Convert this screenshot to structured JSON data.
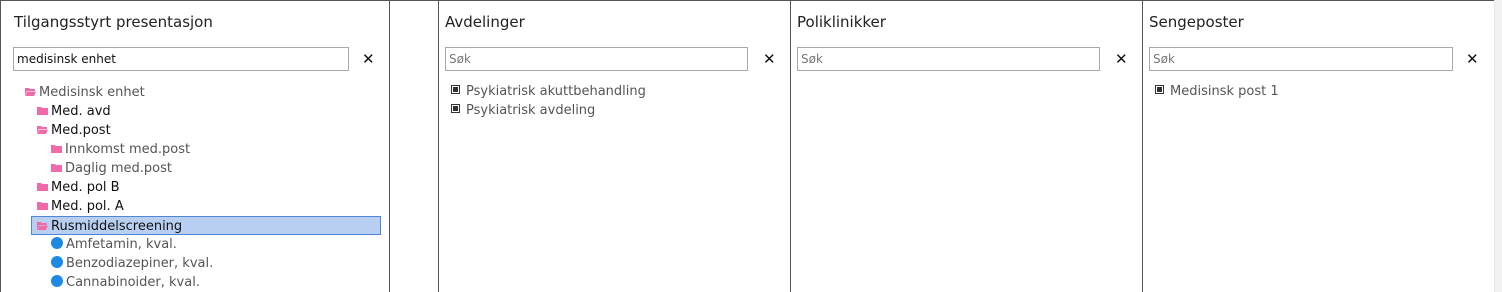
{
  "tilgang": {
    "title": "Tilgangsstyrt presentasjon",
    "search_value": "medisinsk enhet",
    "clear_symbol": "✕",
    "tree": [
      {
        "label": "Medisinsk enhet",
        "type": "folder-open",
        "level": 0,
        "bold": false
      },
      {
        "label": "Med. avd",
        "type": "folder",
        "level": 1,
        "bold": true
      },
      {
        "label": "Med.post",
        "type": "folder-open",
        "level": 1,
        "bold": true
      },
      {
        "label": "Innkomst med.post",
        "type": "folder",
        "level": 2,
        "bold": false
      },
      {
        "label": "Daglig med.post",
        "type": "folder",
        "level": 2,
        "bold": false
      },
      {
        "label": "Med. pol B",
        "type": "folder",
        "level": 1,
        "bold": true
      },
      {
        "label": "Med. pol. A",
        "type": "folder",
        "level": 1,
        "bold": true
      },
      {
        "label": "Rusmiddelscreening",
        "type": "folder-open",
        "level": 1,
        "bold": false,
        "selected": true
      },
      {
        "label": "Amfetamin, kval.",
        "type": "dot",
        "level": 2,
        "bold": false
      },
      {
        "label": "Benzodiazepiner, kval.",
        "type": "dot",
        "level": 2,
        "bold": false
      },
      {
        "label": "Cannabinoider, kval.",
        "type": "dot",
        "level": 2,
        "bold": false
      }
    ]
  },
  "avdelinger": {
    "title": "Avdelinger",
    "search_placeholder": "Søk",
    "clear_symbol": "✕",
    "items": [
      "Psykiatrisk akuttbehandling",
      "Psykiatrisk avdeling"
    ]
  },
  "poliklinikker": {
    "title": "Poliklinikker",
    "search_placeholder": "Søk",
    "clear_symbol": "✕",
    "items": []
  },
  "sengeposter": {
    "title": "Sengeposter",
    "search_placeholder": "Søk",
    "clear_symbol": "✕",
    "items": [
      "Medisinsk post 1"
    ]
  },
  "colors": {
    "folder": "#f06aa8",
    "dot": "#1e88e5",
    "selection_bg": "#b9cff2",
    "selection_border": "#4f86d8"
  }
}
